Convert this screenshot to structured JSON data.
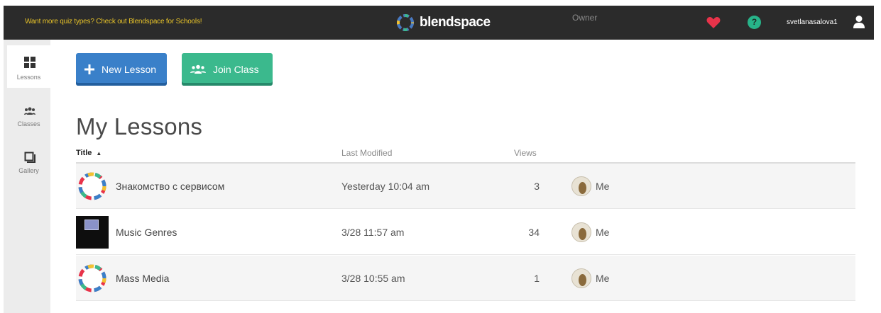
{
  "topbar": {
    "promo": "Want more quiz types? Check out Blendspace for Schools!",
    "brand": "blendspace",
    "help_glyph": "?",
    "username": "svetlanasalova1",
    "icons": [
      "heart-icon",
      "help-icon",
      "user-icon"
    ]
  },
  "sidebar": {
    "items": [
      {
        "label": "Lessons",
        "icon": "grid-icon",
        "active": true
      },
      {
        "label": "Classes",
        "icon": "users-icon",
        "active": false
      },
      {
        "label": "Gallery",
        "icon": "gallery-icon",
        "active": false
      }
    ]
  },
  "actions": {
    "new_lesson": "New Lesson",
    "join_class": "Join Class"
  },
  "main": {
    "title": "My Lessons",
    "columns": {
      "title": "Title",
      "sort_indicator": "▲",
      "modified": "Last Modified",
      "views": "Views",
      "owner": "Owner"
    },
    "rows": [
      {
        "name": "Знакомство с сервисом",
        "modified": "Yesterday 10:04 am",
        "views": "3",
        "owner": "Me",
        "thumb": "blendspace-logo"
      },
      {
        "name": "Music Genres",
        "modified": "3/28 11:57 am",
        "views": "34",
        "owner": "Me",
        "thumb": "dark-screen"
      },
      {
        "name": "Mass Media",
        "modified": "3/28 10:55 am",
        "views": "1",
        "owner": "Me",
        "thumb": "blendspace-logo"
      }
    ]
  },
  "colors": {
    "topbar": "#2b2b2b",
    "promo_text": "#e6c229",
    "new_lesson_button": "#3a80c9",
    "join_class_button": "#3bb98d",
    "heart": "#e8334a",
    "help": "#27b389",
    "sidebar": "#ececec"
  }
}
